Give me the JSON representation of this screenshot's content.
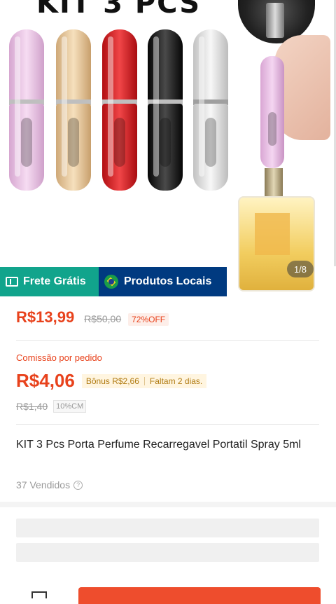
{
  "hero": {
    "title": "KIT 3 PCS",
    "page_indicator": "1/8",
    "atomizer_colors": [
      "#e9c3e4",
      "#e8c99b",
      "#d8181b",
      "#151515",
      "#dcdcdc"
    ]
  },
  "badges": {
    "free_shipping": {
      "icon": "truck-icon",
      "label": "Frete Grátis",
      "color": "#11a48c"
    },
    "local_products": {
      "icon": "brazil-flag-icon",
      "label": "Produtos Locais",
      "color": "#003a80"
    }
  },
  "pricing": {
    "price": "R$13,99",
    "original_price": "R$50,00",
    "discount": "72%OFF"
  },
  "commission": {
    "label": "Comissão por pedido",
    "value": "R$4,06",
    "bonus": "Bônus R$2,66",
    "remaining": "Faltam 2 dias.",
    "base_value": "R$1,40",
    "rate": "10%CM"
  },
  "product": {
    "title": "KIT 3 Pcs Porta Perfume Recarregavel Portatil Spray 5ml",
    "sold": "37 Vendidos"
  },
  "theme": {
    "accent": "#e8421c",
    "buy_button": "#ee4d2d"
  }
}
